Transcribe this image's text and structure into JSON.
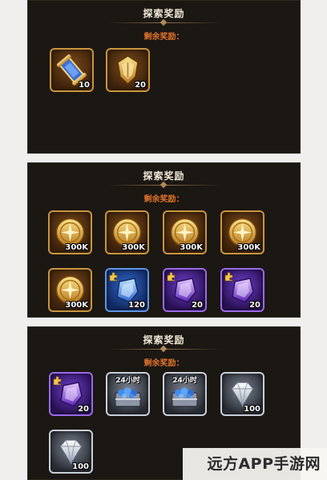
{
  "panels": [
    {
      "title": "探索奖励",
      "subtitle": "剩余奖励：",
      "items": [
        {
          "icon": "scroll-icon",
          "quantity": "10"
        },
        {
          "icon": "gold-shield-icon",
          "quantity": "20"
        }
      ]
    },
    {
      "title": "探索奖励",
      "subtitle": "剩余奖励：",
      "items": [
        {
          "icon": "gold-coin-icon",
          "quantity": "300K"
        },
        {
          "icon": "gold-coin-icon",
          "quantity": "300K"
        },
        {
          "icon": "gold-coin-icon",
          "quantity": "300K"
        },
        {
          "icon": "gold-coin-icon",
          "quantity": "300K"
        },
        {
          "icon": "gold-coin-icon",
          "quantity": "300K"
        },
        {
          "icon": "blue-crystal-shard-icon",
          "quantity": "120"
        },
        {
          "icon": "purple-crystal-shard-icon",
          "quantity": "20"
        },
        {
          "icon": "purple-crystal-shard-icon",
          "quantity": "20"
        }
      ]
    },
    {
      "title": "探索奖励",
      "subtitle": "剩余奖励：",
      "items": [
        {
          "icon": "purple-crystal-shard-icon",
          "quantity": "20"
        },
        {
          "icon": "gem-chest-icon",
          "label": "24小时"
        },
        {
          "icon": "gem-chest-icon",
          "label": "24小时"
        },
        {
          "icon": "diamond-icon",
          "quantity": "100"
        },
        {
          "icon": "diamond-icon",
          "quantity": "100"
        }
      ]
    }
  ],
  "watermark": "远方APP手游网",
  "colors": {
    "panel_bg": "#1b1712",
    "subtitle": "#e0732c",
    "gold_border": "#c9963e",
    "blue_border": "#5e95e6",
    "purple_border": "#9b6ae8"
  }
}
